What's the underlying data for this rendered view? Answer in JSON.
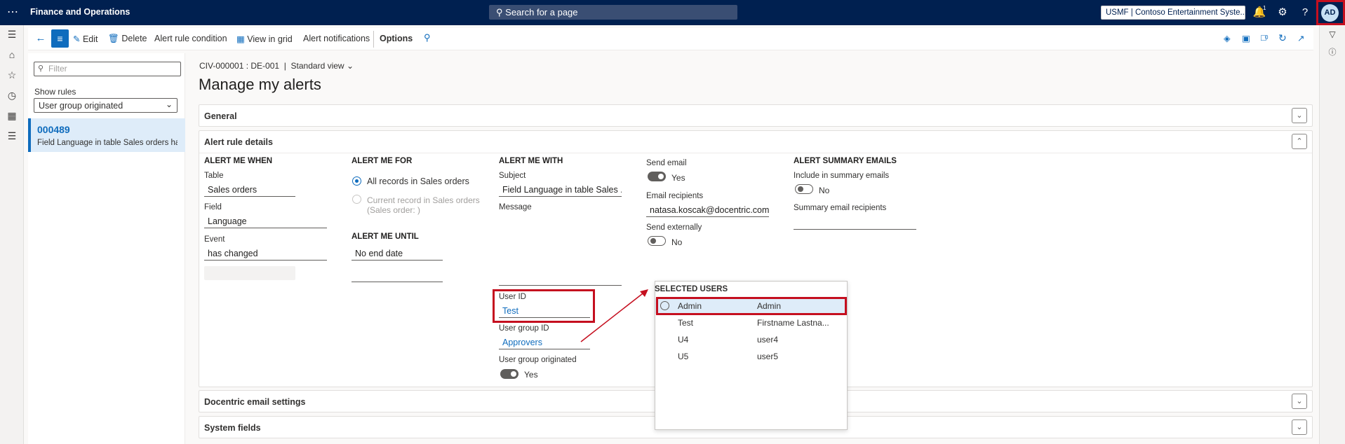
{
  "topbar": {
    "app_title": "Finance and Operations",
    "search_placeholder": "Search for a page",
    "company": "USMF | Contoso Entertainment Syste...",
    "notification_count": "1",
    "avatar_initials": "AD"
  },
  "actionbar": {
    "edit": "Edit",
    "delete": "Delete",
    "alert_rule_condition": "Alert rule condition",
    "view_in_grid": "View in grid",
    "alert_notifications": "Alert notifications",
    "options": "Options",
    "attach_count": "0"
  },
  "listpane": {
    "filter_placeholder": "Filter",
    "show_rules_label": "Show rules",
    "show_rules_value": "User group originated",
    "items": [
      {
        "id": "000489",
        "description": "Field Language in table Sales orders ha..."
      }
    ]
  },
  "header": {
    "breadcrumb": "CIV-000001 : DE-001",
    "separator": "|",
    "view": "Standard view",
    "title": "Manage my alerts"
  },
  "tabs": {
    "general": "General",
    "alert_rule_details": "Alert rule details",
    "docentric": "Docentric email settings",
    "system_fields": "System fields"
  },
  "alert_me_when": {
    "heading": "ALERT ME WHEN",
    "table_label": "Table",
    "table_value": "Sales orders",
    "field_label": "Field",
    "field_value": "Language",
    "event_label": "Event",
    "event_value": "has changed"
  },
  "alert_me_for": {
    "heading": "ALERT ME FOR",
    "option1": "All records in Sales orders",
    "option2_line1": "Current record in Sales orders",
    "option2_line2": "(Sales order: )",
    "selected": 0
  },
  "alert_me_until": {
    "heading": "ALERT ME UNTIL",
    "value": "No end date"
  },
  "alert_me_with": {
    "heading": "ALERT ME WITH",
    "subject_label": "Subject",
    "subject_value": "Field Language in table Sales ...",
    "message_label": "Message",
    "user_id_label": "User ID",
    "user_id_value": "Test",
    "user_group_id_label": "User group ID",
    "user_group_id_value": "Approvers",
    "user_group_originated_label": "User group originated",
    "user_group_originated_value": "Yes"
  },
  "email": {
    "send_email_label": "Send email",
    "send_email_value": "Yes",
    "recipients_label": "Email recipients",
    "recipients_value": "natasa.koscak@docentric.com",
    "send_externally_label": "Send externally",
    "send_externally_value": "No"
  },
  "summary": {
    "heading": "ALERT SUMMARY EMAILS",
    "include_label": "Include in summary emails",
    "include_value": "No",
    "recipients_label": "Summary email recipients"
  },
  "selected_users": {
    "heading": "SELECTED USERS",
    "rows": [
      {
        "id": "Admin",
        "name": "Admin"
      },
      {
        "id": "Test",
        "name": "Firstname Lastna..."
      },
      {
        "id": "U4",
        "name": "user4"
      },
      {
        "id": "U5",
        "name": "user5"
      }
    ]
  },
  "colors": {
    "nav": "#002050",
    "accent": "#0f6cbd",
    "highlight": "#c50f1f",
    "selection": "#deecf9"
  }
}
